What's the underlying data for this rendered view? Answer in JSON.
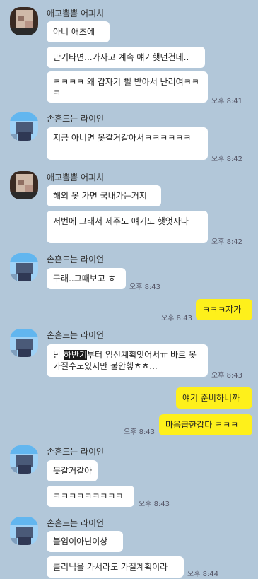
{
  "senders": {
    "friend1": "애교뿜뿜 어피치",
    "friend2": "손흔드는 라이언"
  },
  "messages": {
    "m1": "아니 애초에",
    "m2": "만기타면...가자고 계속 얘기햇던건데..",
    "m3": "ㅋㅋㅋㅋ 왜 갑자기 뻴 받아서 난리여ㅋㅋㅋ",
    "m4": "지금 아니면 못갈거같아서ㅋㅋㅋㅋㅋㅋ",
    "m5": "해외 못 가면 국내가는거지",
    "m6": "저번에 그래서 제주도 얘기도 햇엇자나",
    "m7": "구래..그때보고 ㅎ",
    "m8": "ㅋㅋㅋ쟈가",
    "m9_pre": "난 ",
    "m9_hl": "하반기",
    "m9_post": "부터 임신계획잇어서ㅠ 바로 못가질수도있지만 불안헿ㅎㅎ...",
    "m10": "얘기 준비하니까",
    "m11": "마음급한갑다 ㅋㅋㅋ",
    "m12": "못갈거같아",
    "m13": "ㅋㅋㅋㅋㅋㅋㅋㅋㅋ",
    "m14": "불임이아닌이상",
    "m15": "클리닉을 가서라도 가질계획이라"
  },
  "times": {
    "t1": "오후 8:41",
    "t2": "오후 8:42",
    "t3": "오후 8:42",
    "t4": "오후 8:43",
    "t5": "오후 8:43",
    "t6": "오후 8:43",
    "t7": "오후 8:43",
    "t8": "오후 8:43",
    "t9": "오후 8:44"
  },
  "colors": {
    "background": "#b2c7d9",
    "my_bubble": "#fef01b",
    "their_bubble": "#ffffff"
  }
}
